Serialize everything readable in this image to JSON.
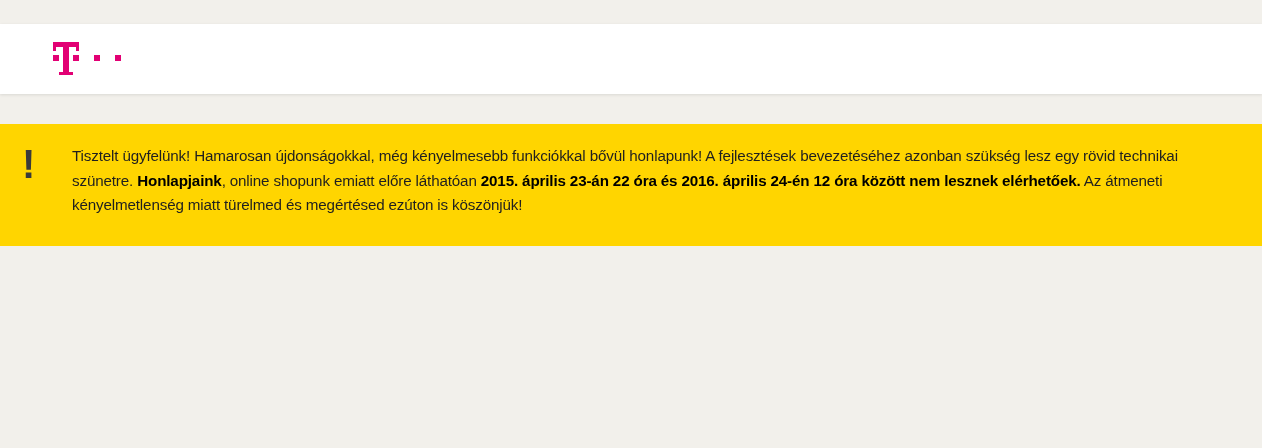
{
  "notice": {
    "icon": "!",
    "message": "Tisztelt ügyfelünk! Hamarosan újdonságokkal, még kényelmesebb funkciókkal bővül honlapunk! A fejlesztések bevezetéséhez azonban szükség lesz egy rövid technikai szünetre. **Honlapjaink**, online shopunk emiatt előre láthatóan **2015. április 23-án 22 óra és 2016. április 24-én 12 óra között nem lesznek elérhetőek.** Az átmeneti kényelmetlenség miatt türelmed és megértésed ezúton is köszönjük!"
  }
}
